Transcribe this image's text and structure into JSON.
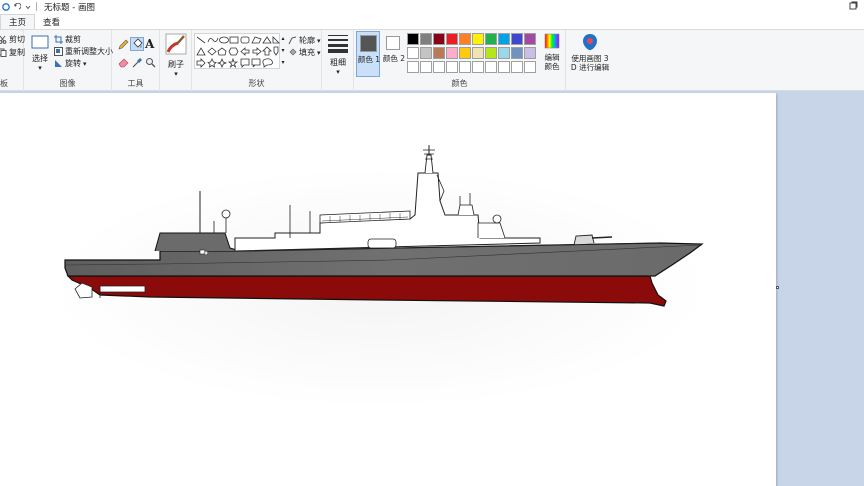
{
  "titlebar": {
    "title": "无标题 - 画图",
    "quick_access": [
      "save-icon",
      "undo-icon",
      "redo-icon",
      "chevron-down-icon"
    ],
    "separator": "|"
  },
  "tabs": [
    {
      "label": "主页",
      "active": true
    },
    {
      "label": "查看",
      "active": false
    }
  ],
  "clipboard": {
    "cut": "剪切",
    "copy": "复制",
    "group_label": "板"
  },
  "image": {
    "select": "选择",
    "crop": "裁剪",
    "resize": "重新调整大小",
    "rotate": "旋转",
    "group_label": "图像"
  },
  "tools": {
    "group_label": "工具",
    "icons": [
      "pencil-icon",
      "fill-bucket-icon",
      "text-icon",
      "eraser-icon",
      "color-picker-icon",
      "magnifier-icon"
    ]
  },
  "brushes": {
    "label": "刷子"
  },
  "shapes": {
    "outline": "轮廓",
    "fill": "填充",
    "group_label": "形状"
  },
  "size": {
    "label": "粗细"
  },
  "colors": {
    "color1_label": "颜色 1",
    "color2_label": "颜色 2",
    "edit_colors_label": "编辑颜色",
    "group_label": "颜色",
    "color1": "#000000",
    "color2": "#ffffff",
    "palette_row1": [
      "#000000",
      "#7f7f7f",
      "#880015",
      "#ed1c24",
      "#ff7f27",
      "#fff200",
      "#22b14c",
      "#00a2e8",
      "#3f48cc",
      "#a349a4"
    ],
    "palette_row2": [
      "#ffffff",
      "#c3c3c3",
      "#b97a57",
      "#ffaec9",
      "#ffc90e",
      "#efe4b0",
      "#b5e61d",
      "#99d9ea",
      "#7092be",
      "#c8bfe7"
    ],
    "palette_row3": [
      "#ffffff",
      "#ffffff",
      "#ffffff",
      "#ffffff",
      "#ffffff",
      "#ffffff",
      "#ffffff",
      "#ffffff",
      "#ffffff",
      "#ffffff"
    ]
  },
  "paint3d": {
    "label_line1": "使用画图 3",
    "label_line2": "D 进行编辑"
  },
  "drawing": {
    "subject": "destroyer-warship",
    "hull_color": "#6b6b6b",
    "below_waterline_color": "#8b0a0a"
  }
}
